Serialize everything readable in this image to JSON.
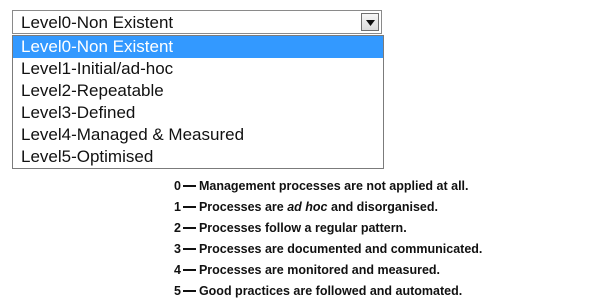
{
  "select": {
    "value": "Level0-Non Existent",
    "options": [
      "Level0-Non Existent",
      "Level1-Initial/ad-hoc",
      "Level2-Repeatable",
      "Level3-Defined",
      "Level4-Managed & Measured",
      "Level5-Optimised"
    ],
    "selected_index": 0,
    "accent_color": "#3399ff"
  },
  "legend": {
    "items": [
      {
        "number": "0",
        "text": "Management processes are not applied at all."
      },
      {
        "number": "1",
        "text_before": "Processes are ",
        "text_em": "ad hoc",
        "text_after": " and disorganised."
      },
      {
        "number": "2",
        "text": "Processes follow a regular pattern."
      },
      {
        "number": "3",
        "text": "Processes are documented and communicated."
      },
      {
        "number": "4",
        "text": "Processes are monitored and measured."
      },
      {
        "number": "5",
        "text": "Good practices are followed and automated."
      }
    ]
  }
}
